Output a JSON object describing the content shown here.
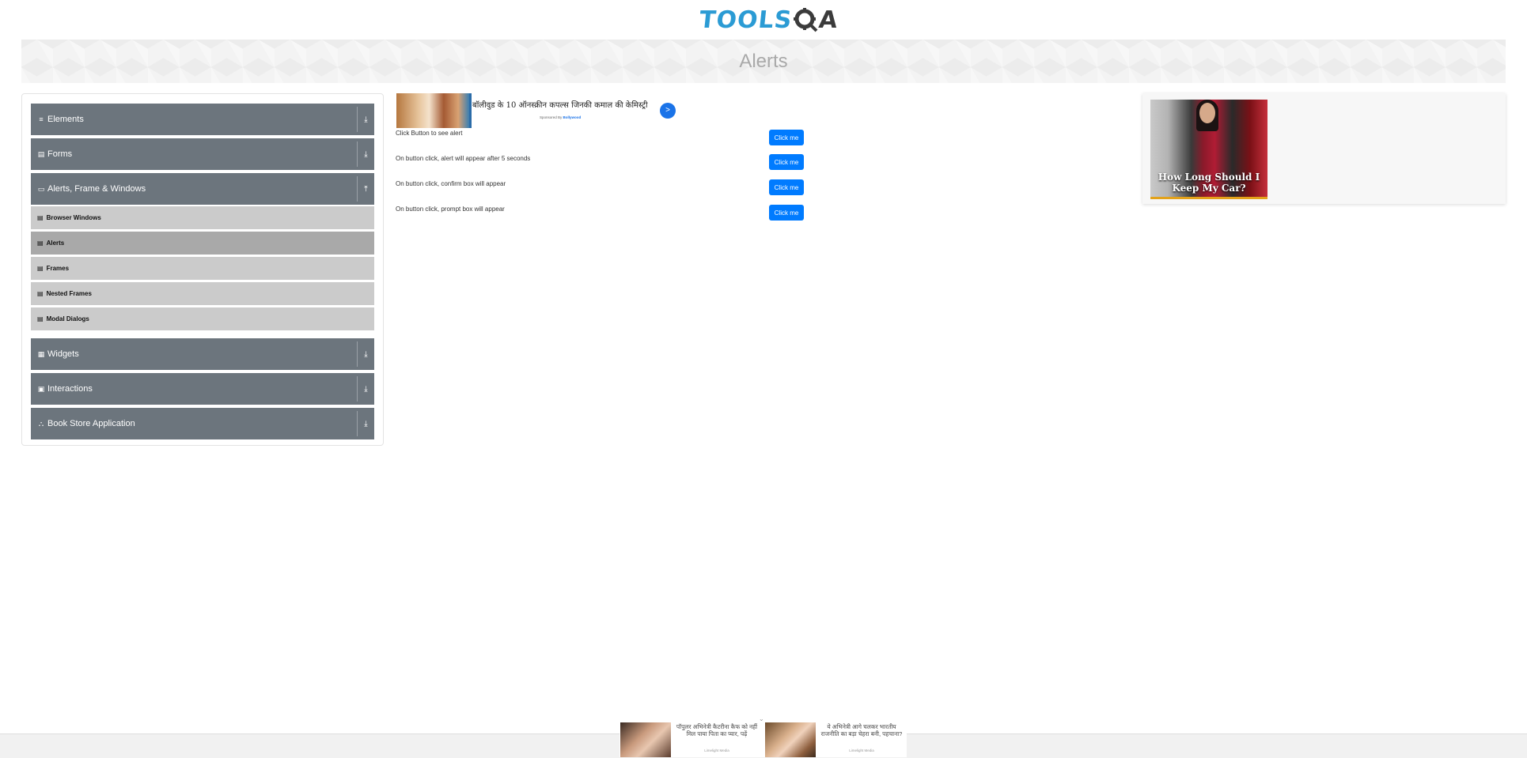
{
  "header": {
    "logo_part1": "TOOLS",
    "logo_part2": "A",
    "page_title": "Alerts"
  },
  "sidebar": {
    "groups": [
      {
        "label": "Elements",
        "icon": "list-icon",
        "glyph": "≡",
        "arrow": "⤓"
      },
      {
        "label": "Forms",
        "icon": "form-icon",
        "glyph": "▤",
        "arrow": "⤓"
      },
      {
        "label": "Alerts, Frame & Windows",
        "icon": "window-icon",
        "glyph": "▭",
        "arrow": "⤒"
      },
      {
        "label": "Widgets",
        "icon": "widgets-icon",
        "glyph": "▦",
        "arrow": "⤓"
      },
      {
        "label": "Interactions",
        "icon": "interactions-icon",
        "glyph": "▣",
        "arrow": "⤓"
      },
      {
        "label": "Book Store Application",
        "icon": "book-store-icon",
        "glyph": "⛬",
        "arrow": "⤓"
      }
    ],
    "sub_items": [
      {
        "label": "Browser Windows",
        "active": false
      },
      {
        "label": "Alerts",
        "active": true
      },
      {
        "label": "Frames",
        "active": false
      },
      {
        "label": "Nested Frames",
        "active": false
      },
      {
        "label": "Modal Dialogs",
        "active": false
      }
    ]
  },
  "ad_top": {
    "text": "बॉलीवुड के 10 ऑनस्क्रीन कपल्स जिनकी कमाल की केमिस्ट्री",
    "sponsored_prefix": "Sponsored By",
    "sponsor": "Bollywood",
    "go": ">"
  },
  "alerts": [
    {
      "label": "Click Button to see alert",
      "button": "Click me"
    },
    {
      "label": "On button click, alert will appear after 5 seconds",
      "button": "Click me"
    },
    {
      "label": "On button click, confirm box will appear",
      "button": "Click me"
    },
    {
      "label": "On button click, prompt box will appear",
      "button": "Click me"
    }
  ],
  "right_ad": {
    "caption": "How Long Should I Keep My Car?"
  },
  "bottom_ads": [
    {
      "text": "पॉपुलर अभिनेत्री कैटरीना कैफ को नहीं मिल पाया पिता का प्यार, पढ़ें",
      "source": "Limelight Media"
    },
    {
      "text": "ये अभिनेत्री आगे चलकर भारतीय राजनीति का बड़ा चेहरा बनी, पहचाना?",
      "source": "Limelight Media"
    }
  ],
  "colors": {
    "sidebar_header": "#6c757d",
    "sub_item": "#cbcbcb",
    "sub_item_active": "#a9a9a9",
    "button": "#007bff",
    "logo_blue": "#2b9bd4"
  }
}
